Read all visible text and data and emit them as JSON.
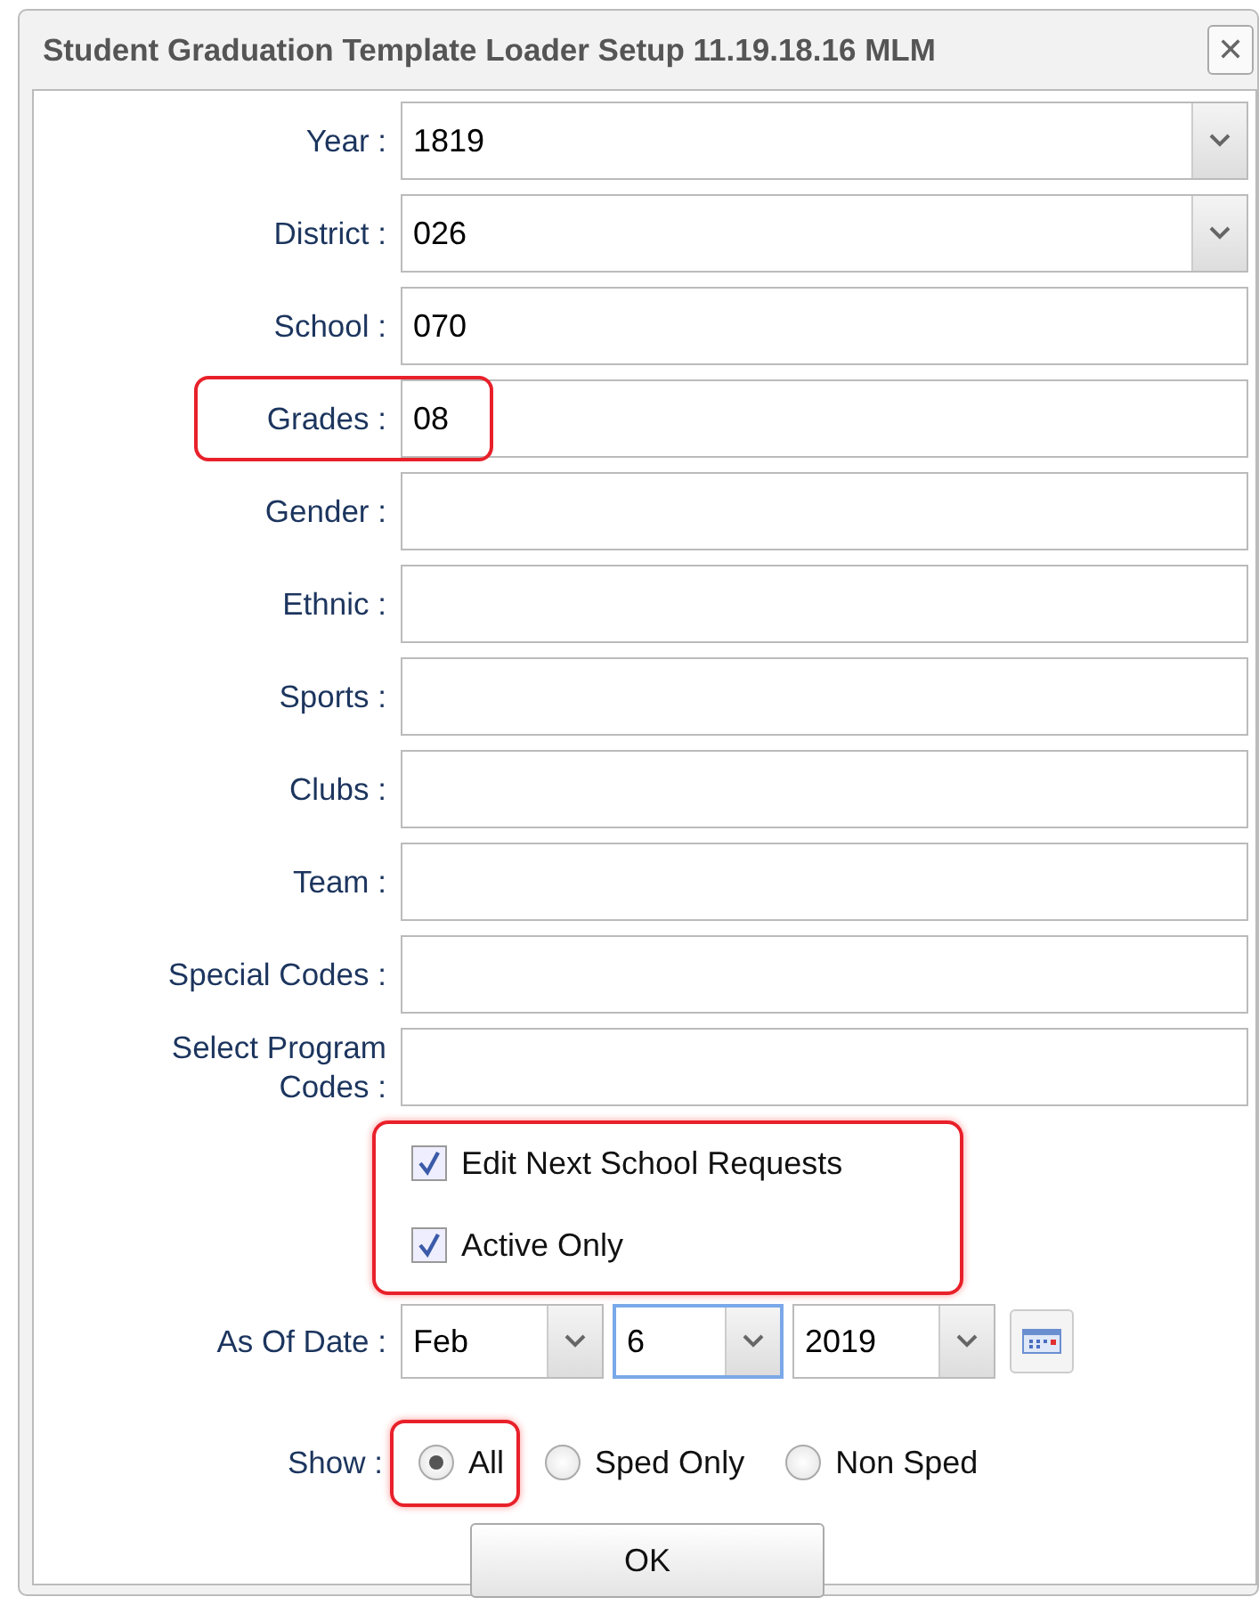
{
  "window": {
    "title": "Student Graduation Template Loader Setup 11.19.18.16 MLM",
    "close": "✕"
  },
  "fields": [
    {
      "label": "Year :",
      "kind": "dropdown",
      "value": "1819",
      "highlighted": false
    },
    {
      "label": "District :",
      "kind": "dropdown",
      "value": "026",
      "highlighted": false
    },
    {
      "label": "School :",
      "kind": "text",
      "value": "070",
      "highlighted": false
    },
    {
      "label": "Grades :",
      "kind": "text",
      "value": "08",
      "highlighted": true
    },
    {
      "label": "Gender :",
      "kind": "text",
      "highlighted": false
    },
    {
      "label": "Ethnic :",
      "kind": "text",
      "highlighted": false
    },
    {
      "label": "Sports :",
      "kind": "text",
      "highlighted": false
    },
    {
      "label": "Clubs :",
      "kind": "text",
      "highlighted": false
    },
    {
      "label": "Team :",
      "kind": "text",
      "highlighted": false
    },
    {
      "label": "Special Codes :",
      "kind": "text",
      "highlighted": false
    },
    {
      "label": "Select Program Codes :",
      "kind": "text",
      "highlighted": false
    }
  ],
  "checkboxes": {
    "highlighted": true,
    "items": [
      {
        "label": "Edit Next School Requests",
        "checked": true
      },
      {
        "label": "Active Only",
        "checked": true
      }
    ]
  },
  "as_of_date": {
    "label": "As Of Date :",
    "parts": [
      {
        "value": "Feb",
        "focused": false
      },
      {
        "value": "6",
        "focused": true
      },
      {
        "value": "2019",
        "focused": false
      }
    ]
  },
  "show": {
    "label": "Show :",
    "options": [
      {
        "label": "All",
        "selected": true,
        "highlighted": true
      },
      {
        "label": "Sped Only",
        "selected": false,
        "highlighted": false
      },
      {
        "label": "Non Sped",
        "selected": false,
        "highlighted": false
      }
    ]
  },
  "ok_button": "OK"
}
